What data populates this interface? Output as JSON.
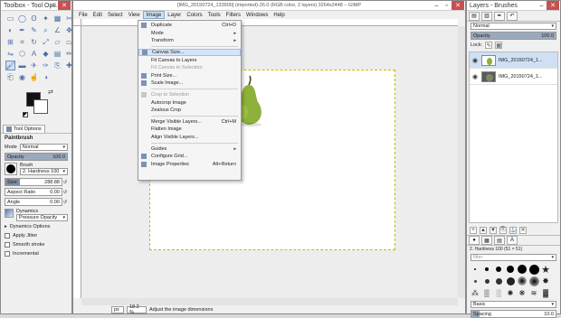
{
  "toolbox": {
    "title": "Toolbox - Tool Opti...",
    "tool_options_tab": "Tool Options",
    "tool_name": "Paintbrush",
    "mode_label": "Mode",
    "mode_value": "Normal",
    "opacity_label": "Opacity",
    "opacity_value": "100.0",
    "brush_label": "Brush",
    "brush_value": "2. Hardness 100",
    "size_label": "Size",
    "size_value": "288.88",
    "aspect_label": "Aspect Ratio",
    "aspect_value": "0.00",
    "angle_label": "Angle",
    "angle_value": "0.00",
    "dynamics_label": "Dynamics",
    "dynamics_value": "Pressure Opacity",
    "dynamics_options": "Dynamics Options",
    "apply_jitter": "Apply Jitter",
    "smooth_stroke": "Smooth stroke",
    "incremental": "Incremental"
  },
  "image_window": {
    "title": "[IMG_20150724_133900] (imported)-26.0 (RGB color, 2 layers) 3264x2448 – GIMP",
    "menu": [
      "File",
      "Edit",
      "Select",
      "View",
      "Image",
      "Layer",
      "Colors",
      "Tools",
      "Filters",
      "Windows",
      "Help"
    ],
    "status_unit": "px",
    "status_zoom": "18.2 %",
    "status_message": "Adjust the image dimensions"
  },
  "image_menu": [
    {
      "label": "Duplicate",
      "shortcut": "Ctrl+D",
      "icon": "duplicate-icon"
    },
    {
      "label": "Mode",
      "submenu": true
    },
    {
      "label": "Transform",
      "submenu": true
    },
    {
      "sep": true
    },
    {
      "label": "Canvas Size...",
      "icon": "canvas-size-icon",
      "highlighted": true
    },
    {
      "label": "Fit Canvas to Layers"
    },
    {
      "label": "Fit Canvas to Selection",
      "disabled": true
    },
    {
      "label": "Print Size...",
      "icon": "print-size-icon"
    },
    {
      "label": "Scale Image...",
      "icon": "scale-image-icon"
    },
    {
      "sep": true
    },
    {
      "label": "Crop to Selection",
      "icon": "crop-icon",
      "disabled": true
    },
    {
      "label": "Autocrop Image"
    },
    {
      "label": "Zealous Crop"
    },
    {
      "sep": true
    },
    {
      "label": "Merge Visible Layers...",
      "shortcut": "Ctrl+M"
    },
    {
      "label": "Flatten Image"
    },
    {
      "label": "Align Visible Layers..."
    },
    {
      "sep": true
    },
    {
      "label": "Guides",
      "submenu": true
    },
    {
      "label": "Configure Grid...",
      "icon": "grid-icon"
    },
    {
      "label": "Image Properties",
      "shortcut": "Alt+Return",
      "icon": "info-icon"
    }
  ],
  "layers_dock": {
    "title": "Layers - Brushes",
    "mode_value": "Normal",
    "opacity_label": "Opacity",
    "opacity_value": "100.0",
    "lock_label": "Lock:",
    "layers": [
      {
        "name": "IMG_20150724_1...",
        "selected": true
      },
      {
        "name": "IMG_20150724_1...",
        "selected": false
      }
    ],
    "brush_name": "2. Hardness 100 (51 × 51)",
    "filter_placeholder": "filter",
    "brush_tag": "Basic",
    "spacing_label": "Spacing",
    "spacing_value": "10.0"
  },
  "colors": {
    "accent": "#cfe0f4",
    "pear_green": "#8db13a",
    "close_red": "#c75050"
  }
}
